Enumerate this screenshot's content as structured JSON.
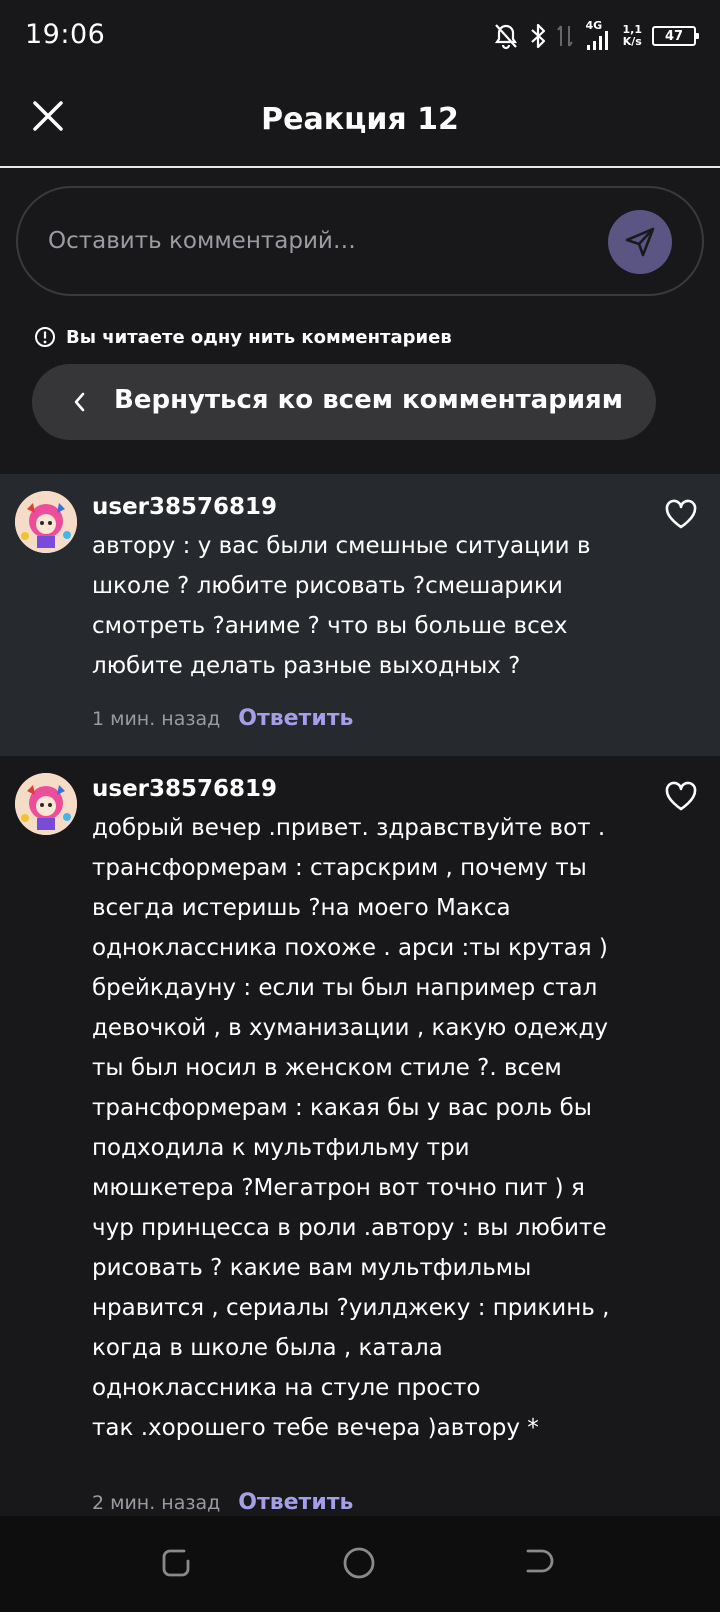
{
  "status_bar": {
    "time": "19:06",
    "network": "4G",
    "speed_value": "1,1",
    "speed_unit": "K/s",
    "battery": "47"
  },
  "header": {
    "title": "Реакция 12",
    "close_icon": "close-icon"
  },
  "composer": {
    "placeholder": "Оставить комментарий…",
    "send_icon": "send-icon",
    "send_color": "#5a5582"
  },
  "thread": {
    "notice": "Вы читаете одну нить комментариев",
    "back_label": "Вернуться ко всем комментариям"
  },
  "comments": [
    {
      "username": "user38576819",
      "text": "автору : у вас были смешные ситуации в\nшколе ? любите рисовать ?смешарики\nсмотреть ?аниме ? что вы больше всех\nлюбите делать разные выходных ?",
      "time": "1 мин. назад",
      "reply_label": "Ответить",
      "highlighted": true
    },
    {
      "username": "user38576819",
      "text": "добрый вечер .привет. здравствуйте вот .\nтрансформерам :  старскрим , почему ты\nвсегда истеришь ?на моего Макса\nодноклассника похоже . арси :ты крутая )\nбрейкдауну : если ты был например стал\nдевочкой , в хуманизации , какую одежду\nты был носил в женском стиле ?. всем\nтрансформерам : какая бы у вас роль бы\nподходила к мультфильму три\nмюшкетера ?Мегатрон вот точно пит ) я\nчур принцесса в роли .автору : вы любите\nрисовать ? какие вам мультфильмы\nнравится , сериалы ?уилджеку : прикинь ,\nкогда в школе была , катала\nодноклассника на стуле просто\nтак .хорошего тебе вечера )автору *",
      "time": "2 мин. назад",
      "reply_label": "Ответить",
      "highlighted": false
    }
  ],
  "colors": {
    "background": "#18181a",
    "highlighted_comment": "#26292e",
    "reply_accent": "#a59fe8",
    "pill": "#363639"
  }
}
